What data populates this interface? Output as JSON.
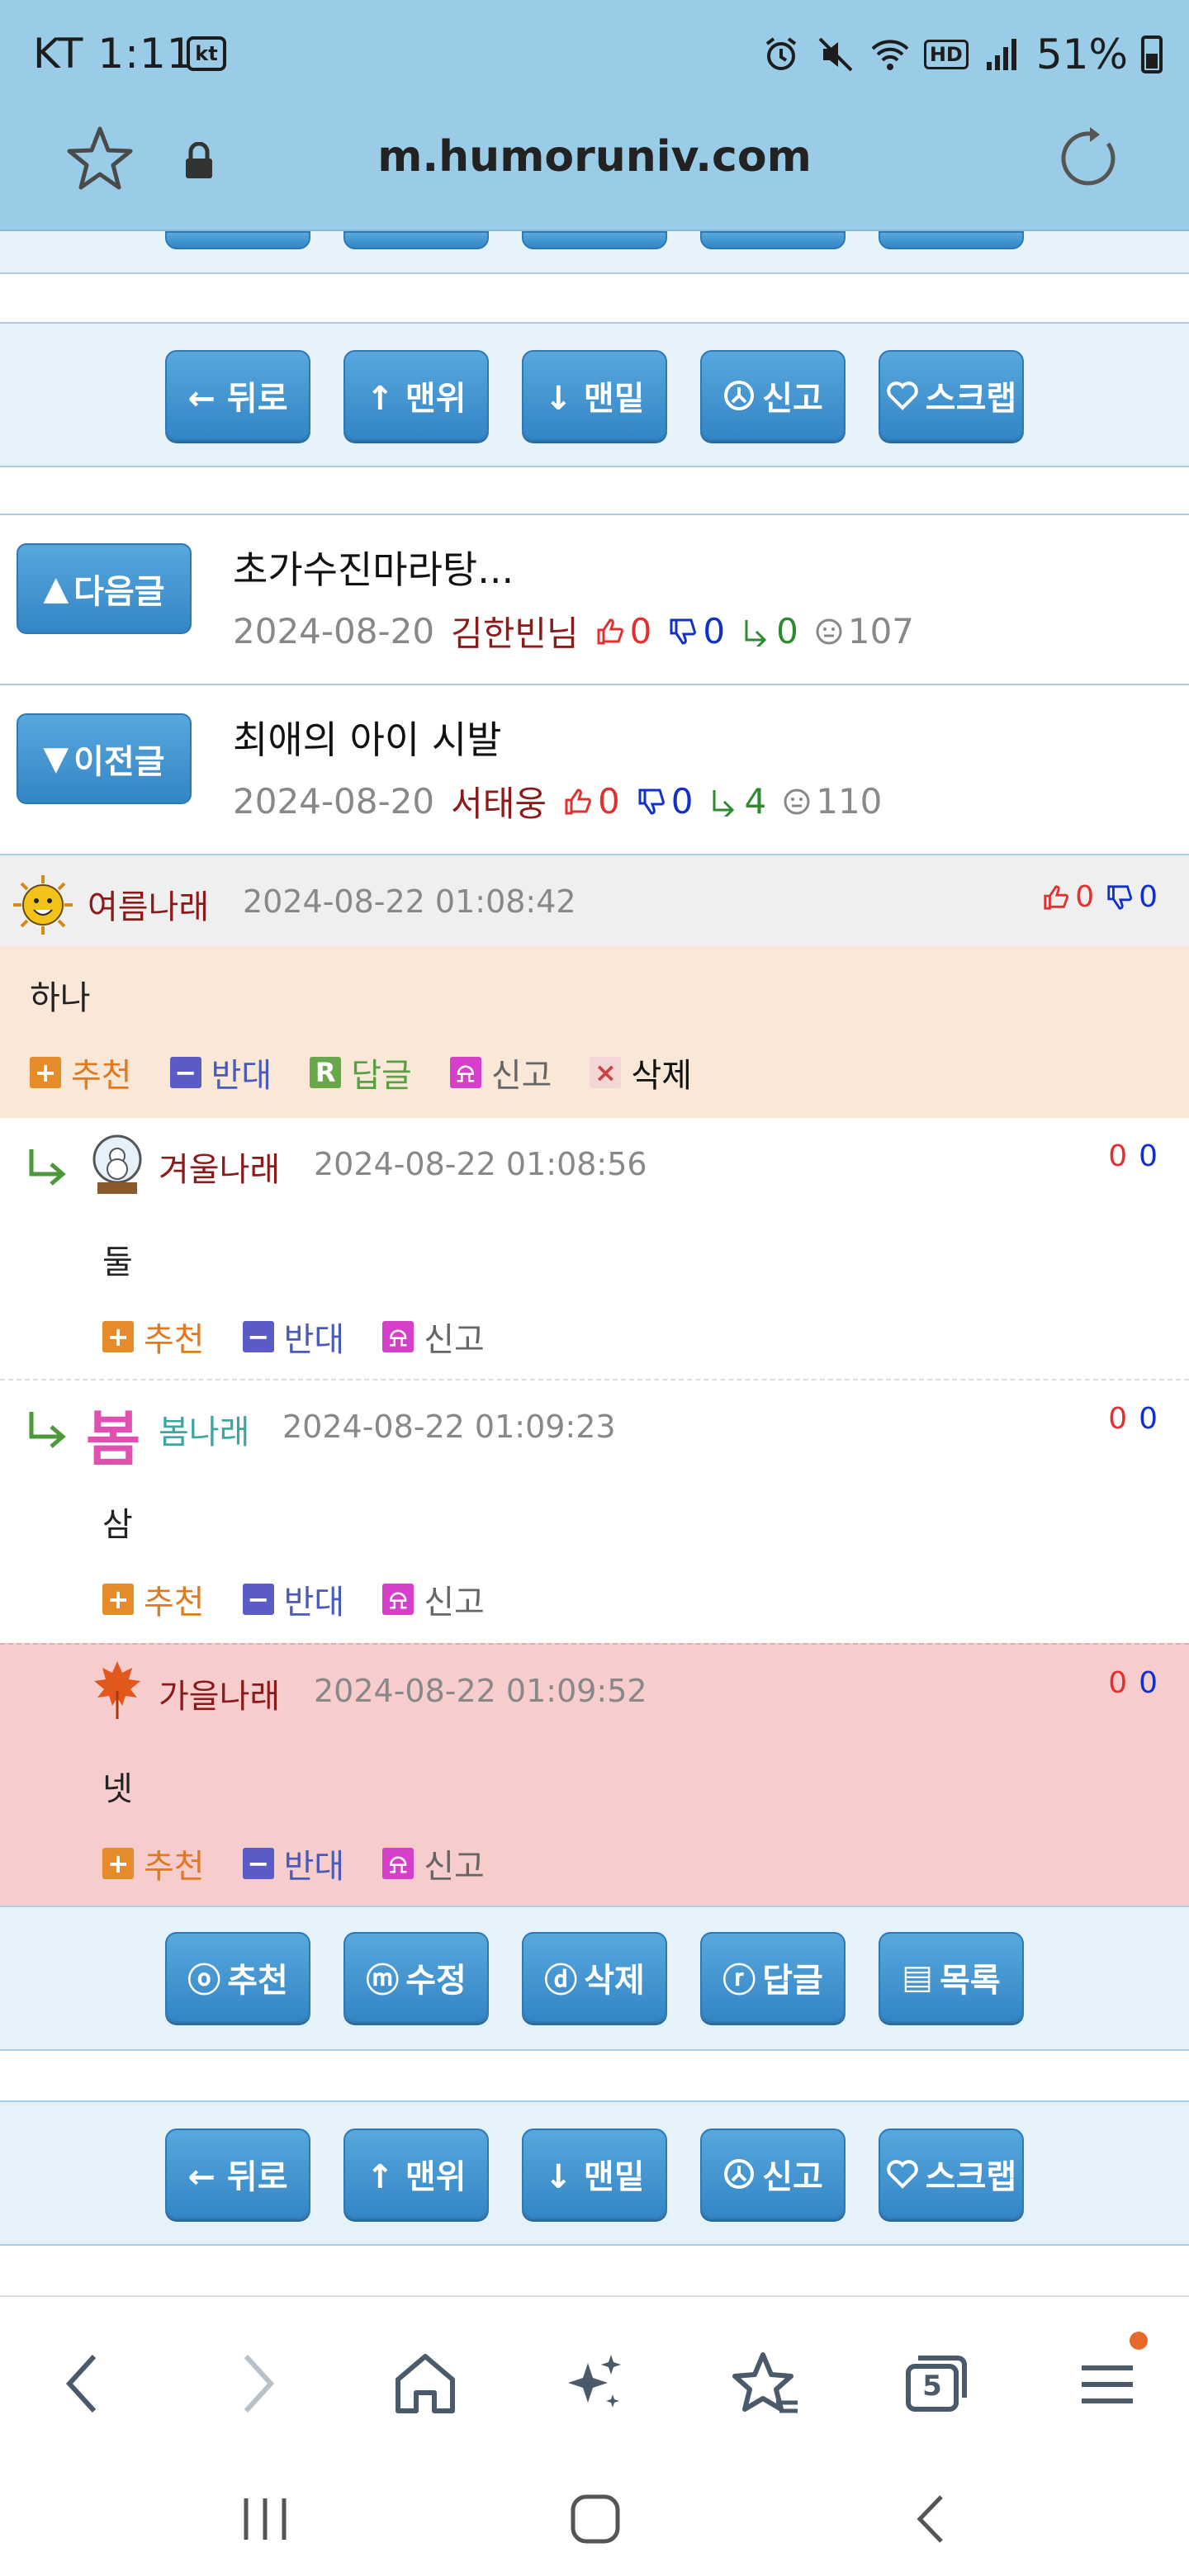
{
  "status": {
    "time": "KT 1:11",
    "carrier_badge": "kt",
    "hd": "HD",
    "battery": "51%"
  },
  "browser": {
    "url": "m.humoruniv.com",
    "tab_count": "5"
  },
  "nav_buttons": [
    "← 뒤로",
    "↑ 맨위",
    "↓ 맨밑",
    "신고",
    "스크랩"
  ],
  "next_post": {
    "label": "다음글",
    "title": "초가수진마라탕...",
    "date": "2024-08-20",
    "author": "김한빈님",
    "up": "0",
    "down": "0",
    "replies": "0",
    "views": "107"
  },
  "prev_post": {
    "label": "이전글",
    "title": "최애의 아이 시발",
    "date": "2024-08-20",
    "author": "서태웅",
    "up": "0",
    "down": "0",
    "replies": "4",
    "views": "110"
  },
  "comments": [
    {
      "author": "여름나래",
      "date": "2024-08-22 01:08:42",
      "up": "0",
      "down": "0",
      "body": "하나",
      "actions": {
        "recommend": "추천",
        "oppose": "반대",
        "reply": "답글",
        "report": "신고",
        "delete": "삭제"
      }
    },
    {
      "author": "겨울나래",
      "date": "2024-08-22 01:08:56",
      "up": "0",
      "down": "0",
      "body": "둘",
      "actions": {
        "recommend": "추천",
        "oppose": "반대",
        "report": "신고"
      }
    },
    {
      "author": "봄나래",
      "avatar_text": "봄",
      "date": "2024-08-22 01:09:23",
      "up": "0",
      "down": "0",
      "body": "삼",
      "actions": {
        "recommend": "추천",
        "oppose": "반대",
        "report": "신고"
      }
    },
    {
      "author": "가을나래",
      "date": "2024-08-22 01:09:52",
      "up": "0",
      "down": "0",
      "body": "넷",
      "actions": {
        "recommend": "추천",
        "oppose": "반대",
        "report": "신고"
      }
    }
  ],
  "post_buttons": [
    "추천",
    "수정",
    "삭제",
    "답글",
    "목록"
  ],
  "colors": {
    "topbar": "#9acbe7",
    "button": "#3f93d1",
    "bar_bg": "#e6f2fa",
    "highlight_comment": "#f6cccd",
    "first_comment": "#f9e8d8"
  }
}
